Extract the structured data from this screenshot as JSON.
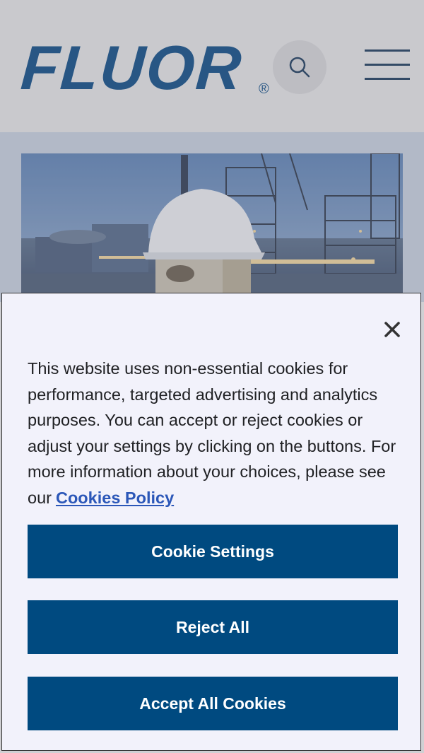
{
  "header": {
    "logo_text": "FLUOR",
    "registered_mark": "®",
    "search_icon": "search-icon",
    "menu_icon": "hamburger-menu-icon"
  },
  "hero": {
    "image_alt": "construction worker in hard hat at industrial plant"
  },
  "cookie_dialog": {
    "message": "This website uses non-essential cookies for performance, targeted advertising and analytics purposes. You can accept or reject cookies or adjust your settings by clicking on the buttons. For more information about your choices, please see our",
    "policy_link": "Cookies Policy",
    "close_icon": "close-icon",
    "buttons": {
      "settings": "Cookie Settings",
      "reject": "Reject All",
      "accept": "Accept All Cookies"
    }
  },
  "colors": {
    "brand": "#0a4a85",
    "button": "#004a80",
    "link": "#2b57b8",
    "dialog_bg": "#f2f2fb"
  }
}
